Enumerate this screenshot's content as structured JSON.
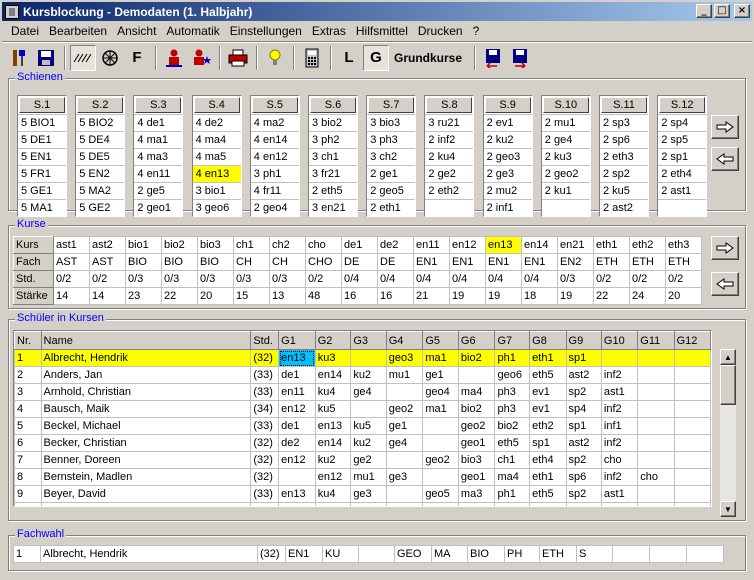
{
  "window": {
    "title": "Kursblockung - Demodaten (1. Halbjahr)",
    "buttons": [
      "_",
      "□",
      "×"
    ]
  },
  "menu": [
    "Datei",
    "Bearbeiten",
    "Ansicht",
    "Automatik",
    "Einstellungen",
    "Extras",
    "Hilfsmittel",
    "Drucken",
    "?"
  ],
  "toolbar": {
    "icons": [
      "tool-icon",
      "save-icon",
      "hatch-icon",
      "wheel-icon",
      "F",
      "person-icon",
      "person-star-icon",
      "print-icon",
      "lightbulb-icon",
      "calculator-icon",
      "L",
      "G"
    ],
    "label": "Grundkurse"
  },
  "schienen": {
    "caption": "Schienen",
    "columns": [
      {
        "header": "S.1",
        "rows": [
          "5 BIO1",
          "5 DE1",
          "5 EN1",
          "5 FR1",
          "5 GE1",
          "5 MA1"
        ]
      },
      {
        "header": "S.2",
        "rows": [
          "5 BIO2",
          "5 DE4",
          "5 DE5",
          "5 EN2",
          "5 MA2",
          "5 GE2"
        ]
      },
      {
        "header": "S.3",
        "rows": [
          "4 de1",
          "4 ma1",
          "4 ma3",
          "4 en11",
          "2 ge5",
          "2 geo1"
        ]
      },
      {
        "header": "S.4",
        "rows": [
          "4 de2",
          "4 ma4",
          "4 ma5",
          "4 en13",
          "3 bio1",
          "3 geo6"
        ]
      },
      {
        "header": "S.5",
        "rows": [
          "4 ma2",
          "4 en14",
          "4 en12",
          "3 ph1",
          "4 fr11",
          "2 geo4"
        ]
      },
      {
        "header": "S.6",
        "rows": [
          "3 bio2",
          "3 ph2",
          "3 ch1",
          "3 fr21",
          "2 eth5",
          "3 en21"
        ]
      },
      {
        "header": "S.7",
        "rows": [
          "3 bio3",
          "3 ph3",
          "3 ch2",
          "2 ge1",
          "2 geo5",
          "2 eth1"
        ]
      },
      {
        "header": "S.8",
        "rows": [
          "3 ru21",
          "2 inf2",
          "2 ku4",
          "2 ge2",
          "2 eth2",
          ""
        ]
      },
      {
        "header": "S.9",
        "rows": [
          "2 ev1",
          "2 ku2",
          "2 geo3",
          "2 ge3",
          "2 mu2",
          "2 inf1"
        ]
      },
      {
        "header": "S.10",
        "rows": [
          "2 mu1",
          "2 ge4",
          "2 ku3",
          "2 geo2",
          "2 ku1",
          ""
        ]
      },
      {
        "header": "S.11",
        "rows": [
          "2 sp3",
          "2 sp6",
          "2 eth3",
          "2 sp2",
          "2 ku5",
          "2 ast2"
        ]
      },
      {
        "header": "S.12",
        "rows": [
          "2 sp4",
          "2 sp5",
          "2 sp1",
          "2 eth4",
          "2 ast1",
          ""
        ]
      }
    ]
  },
  "kurse": {
    "caption": "Kurse",
    "row_headers": [
      "Kurs",
      "Fach",
      "Std.",
      "Stärke"
    ],
    "kurs": [
      "ast1",
      "ast2",
      "bio1",
      "bio2",
      "bio3",
      "ch1",
      "ch2",
      "cho",
      "de1",
      "de2",
      "en11",
      "en12",
      "en13",
      "en14",
      "en21",
      "eth1",
      "eth2",
      "eth3"
    ],
    "fach": [
      "AST",
      "AST",
      "BIO",
      "BIO",
      "BIO",
      "CH",
      "CH",
      "CHO",
      "DE",
      "DE",
      "EN1",
      "EN1",
      "EN1",
      "EN1",
      "EN2",
      "ETH",
      "ETH",
      "ETH"
    ],
    "std": [
      "0/2",
      "0/2",
      "0/3",
      "0/3",
      "0/3",
      "0/3",
      "0/3",
      "0/2",
      "0/4",
      "0/4",
      "0/4",
      "0/4",
      "0/4",
      "0/4",
      "0/3",
      "0/2",
      "0/2",
      "0/2"
    ],
    "staerke": [
      "14",
      "14",
      "23",
      "22",
      "20",
      "15",
      "13",
      "48",
      "16",
      "16",
      "21",
      "19",
      "19",
      "18",
      "19",
      "22",
      "24",
      "20"
    ]
  },
  "schueler": {
    "caption": "Schüler in Kursen",
    "columns": [
      "Nr.",
      "Name",
      "Std.",
      "G1",
      "G2",
      "G3",
      "G4",
      "G5",
      "G6",
      "G7",
      "G8",
      "G9",
      "G10",
      "G11",
      "G12"
    ],
    "rows": [
      [
        "1",
        "Albrecht, Hendrik",
        "(32)",
        "en13",
        "ku3",
        "",
        "geo3",
        "ma1",
        "bio2",
        "ph1",
        "eth1",
        "sp1",
        "",
        "",
        ""
      ],
      [
        "2",
        "Anders, Jan",
        "(33)",
        "de1",
        "en14",
        "ku2",
        "mu1",
        "ge1",
        "",
        "geo6",
        "eth5",
        "ast2",
        "inf2",
        "",
        ""
      ],
      [
        "3",
        "Arnhold, Christian",
        "(33)",
        "en11",
        "ku4",
        "ge4",
        "",
        "geo4",
        "ma4",
        "ph3",
        "ev1",
        "sp2",
        "ast1",
        "",
        ""
      ],
      [
        "4",
        "Bausch, Maik",
        "(34)",
        "en12",
        "ku5",
        "",
        "geo2",
        "ma1",
        "bio2",
        "ph3",
        "ev1",
        "sp4",
        "inf2",
        "",
        ""
      ],
      [
        "5",
        "Beckel, Michael",
        "(33)",
        "de1",
        "en13",
        "ku5",
        "ge1",
        "",
        "geo2",
        "bio2",
        "eth2",
        "sp1",
        "inf1",
        "",
        ""
      ],
      [
        "6",
        "Becker, Christian",
        "(32)",
        "de2",
        "en14",
        "ku2",
        "ge4",
        "",
        "geo1",
        "eth5",
        "sp1",
        "ast2",
        "inf2",
        "",
        ""
      ],
      [
        "7",
        "Benner, Doreen",
        "(32)",
        "en12",
        "ku2",
        "ge2",
        "",
        "geo2",
        "bio3",
        "ch1",
        "eth4",
        "sp2",
        "cho",
        "",
        ""
      ],
      [
        "8",
        "Bernstein, Madlen",
        "(32)",
        "",
        "en12",
        "mu1",
        "ge3",
        "",
        "geo1",
        "ma4",
        "eth1",
        "sp6",
        "inf2",
        "cho",
        ""
      ],
      [
        "9",
        "Beyer, David",
        "(33)",
        "en13",
        "ku4",
        "ge3",
        "",
        "geo5",
        "ma3",
        "ph1",
        "eth5",
        "sp2",
        "ast1",
        "",
        ""
      ],
      [
        "10",
        "Bley, Mario",
        "(33)",
        "en14",
        "ku2",
        "ge5",
        "",
        "geo2",
        "ma4",
        "ch2",
        "eth5",
        "sp4",
        "cho",
        "",
        ""
      ]
    ]
  },
  "fachwahl": {
    "caption": "Fachwahl",
    "row": [
      "1",
      "Albrecht, Hendrik",
      "(32)",
      "EN1",
      "KU",
      "",
      "GEO",
      "MA",
      "BIO",
      "PH",
      "ETH",
      "S",
      "",
      "",
      ""
    ]
  },
  "colors": {
    "titlebar_start": "#0a246a",
    "titlebar_end": "#a6caf0",
    "caption": "#0000ff",
    "highlight": "#ffff00",
    "cell_selected": "#00c0ff"
  }
}
